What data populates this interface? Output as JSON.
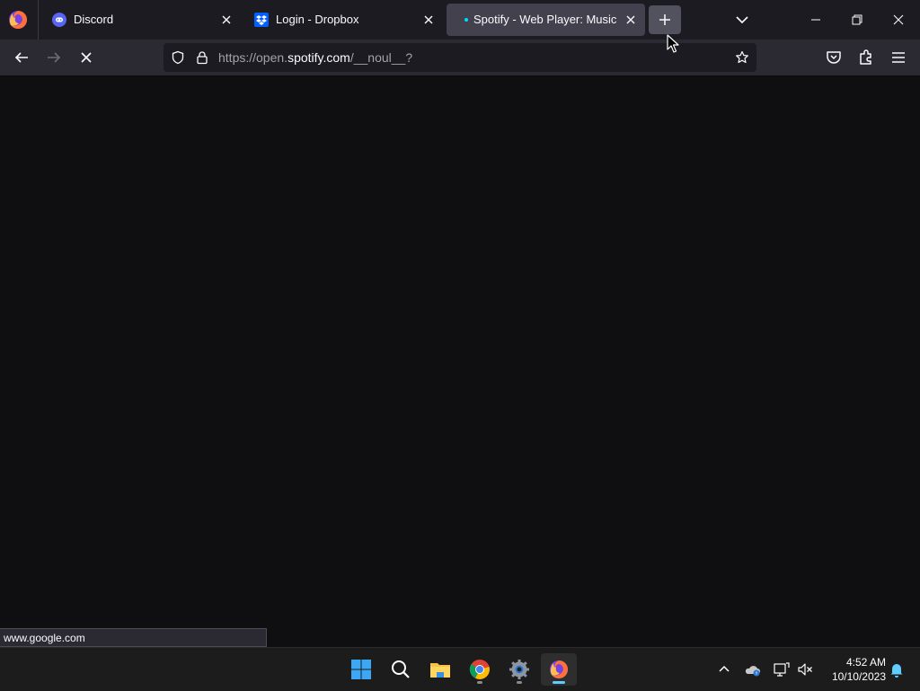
{
  "browser": {
    "tabs": [
      {
        "title": "Discord",
        "icon": "discord-icon"
      },
      {
        "title": "Login - Dropbox",
        "icon": "dropbox-icon"
      },
      {
        "title": "Spotify - Web Player: Music for everyone",
        "icon": "loading-dot-icon",
        "active": true
      }
    ],
    "new_tab_icon": "plus-icon",
    "url": {
      "prefix": "https://open.",
      "host": "spotify.com",
      "path": "/__noul__?"
    }
  },
  "status_bar": {
    "text": "www.google.com"
  },
  "taskbar": {
    "apps": [
      "start-icon",
      "search-icon",
      "file-explorer-icon",
      "chrome-icon",
      "settings-icon",
      "firefox-icon"
    ],
    "clock": {
      "time": "4:52 AM",
      "date": "10/10/2023"
    }
  },
  "colors": {
    "tabstrip": "#1c1b22",
    "toolbar": "#2b2a33",
    "content": "#0f0e10",
    "taskbar": "#1c1c1c",
    "accent": "#60cdff"
  }
}
